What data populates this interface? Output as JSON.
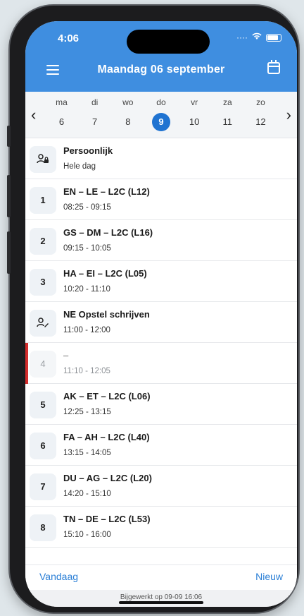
{
  "status": {
    "time": "4:06"
  },
  "header": {
    "title": "Maandag 06 september"
  },
  "week": {
    "days": [
      {
        "name": "ma",
        "date": "6"
      },
      {
        "name": "di",
        "date": "7"
      },
      {
        "name": "wo",
        "date": "8"
      },
      {
        "name": "do",
        "date": "9"
      },
      {
        "name": "vr",
        "date": "10"
      },
      {
        "name": "za",
        "date": "11"
      },
      {
        "name": "zo",
        "date": "12"
      }
    ],
    "selected_date": "9"
  },
  "items": [
    {
      "badge": "",
      "icon": "person-lock-icon",
      "title": "Persoonlijk",
      "time": "Hele dag"
    },
    {
      "badge": "1",
      "title": "EN – LE – L2C (L12)",
      "time": "08:25 - 09:15"
    },
    {
      "badge": "2",
      "title": "GS – DM – L2C (L16)",
      "time": "09:15 - 10:05"
    },
    {
      "badge": "3",
      "title": "HA – EI – L2C (L05)",
      "time": "10:20 - 11:10"
    },
    {
      "badge": "",
      "icon": "person-edit-icon",
      "title": "NE Opstel schrijven",
      "time": "11:00 - 12:00"
    },
    {
      "badge": "4",
      "title": "–",
      "time": "11:10 - 12:05"
    },
    {
      "badge": "5",
      "title": "AK – ET – L2C (L06)",
      "time": "12:25 - 13:15"
    },
    {
      "badge": "6",
      "title": "FA – AH – L2C (L40)",
      "time": "13:15 - 14:05"
    },
    {
      "badge": "7",
      "title": "DU – AG – L2C (L20)",
      "time": "14:20 - 15:10"
    },
    {
      "badge": "8",
      "title": "TN – DE – L2C (L53)",
      "time": "15:10 - 16:00"
    }
  ],
  "footer": {
    "today_label": "Vandaag",
    "new_label": "Nieuw",
    "updated_text": "Bijgewerkt op 09-09 16:06"
  },
  "colors": {
    "accent": "#3f8ee0",
    "selected": "#1f73d1",
    "link": "#2b7fd6",
    "cancelled": "#d42c2c"
  }
}
